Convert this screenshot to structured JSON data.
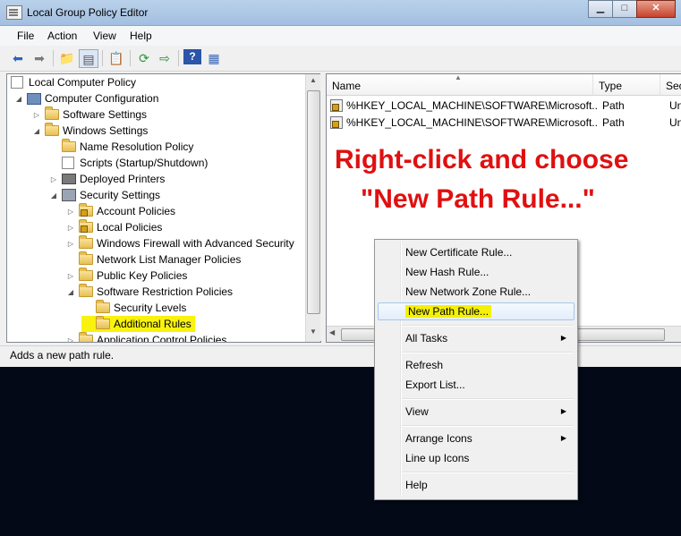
{
  "window": {
    "title": "Local Group Policy Editor"
  },
  "menu": [
    "File",
    "Action",
    "View",
    "Help"
  ],
  "toolbar_icons": [
    "back-arrow-icon",
    "forward-arrow-icon",
    "up-folder-icon",
    "show-hide-tree-icon",
    "properties-icon",
    "refresh-icon",
    "export-list-icon",
    "help-icon",
    "action-pane-icon"
  ],
  "tree": {
    "root": "Local Computer Policy",
    "computer_configuration": "Computer Configuration",
    "software_settings": "Software Settings",
    "windows_settings": "Windows Settings",
    "name_resolution_policy": "Name Resolution Policy",
    "scripts": "Scripts (Startup/Shutdown)",
    "deployed_printers": "Deployed Printers",
    "security_settings": "Security Settings",
    "account_policies": "Account Policies",
    "local_policies": "Local Policies",
    "windows_firewall": "Windows Firewall with Advanced Security",
    "network_list": "Network List Manager Policies",
    "public_key": "Public Key Policies",
    "software_restriction": "Software Restriction Policies",
    "security_levels": "Security Levels",
    "additional_rules": "Additional Rules",
    "application_control": "Application Control Policies"
  },
  "list": {
    "columns": [
      "Name",
      "Type",
      "Secu"
    ],
    "rows": [
      {
        "name": "%HKEY_LOCAL_MACHINE\\SOFTWARE\\Microsoft...",
        "type": "Path",
        "security": "Unre"
      },
      {
        "name": "%HKEY_LOCAL_MACHINE\\SOFTWARE\\Microsoft...",
        "type": "Path",
        "security": "Unre"
      }
    ]
  },
  "annotation": {
    "line1": "Right-click and choose",
    "line2": "\"New Path Rule...\""
  },
  "context_menu": {
    "new_certificate_rule": "New Certificate Rule...",
    "new_hash_rule": "New Hash Rule...",
    "new_network_zone_rule": "New Network Zone Rule...",
    "new_path_rule": "New Path Rule...",
    "all_tasks": "All Tasks",
    "refresh": "Refresh",
    "export_list": "Export List...",
    "view": "View",
    "arrange_icons": "Arrange Icons",
    "line_up_icons": "Line up Icons",
    "help": "Help"
  },
  "status": "Adds a new path rule.",
  "colors": {
    "annotation": "#e01010",
    "highlight": "#f9f20f",
    "desktop": "#040918"
  }
}
